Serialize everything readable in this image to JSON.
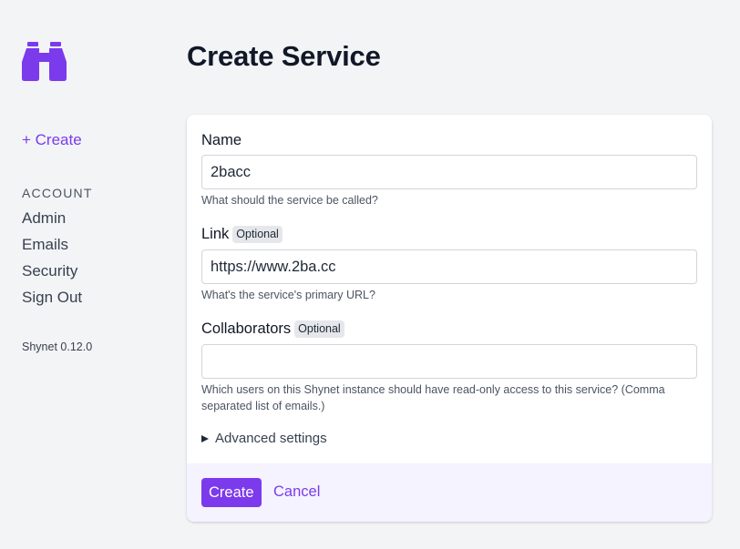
{
  "sidebar": {
    "logo_icon": "binoculars-icon",
    "create_label": "+ Create",
    "account_heading": "ACCOUNT",
    "items": [
      {
        "label": "Admin"
      },
      {
        "label": "Emails"
      },
      {
        "label": "Security"
      },
      {
        "label": "Sign Out"
      }
    ],
    "version": "Shynet 0.12.0"
  },
  "page": {
    "title": "Create Service"
  },
  "form": {
    "name": {
      "label": "Name",
      "value": "2bacc",
      "help": "What should the service be called?"
    },
    "link": {
      "label": "Link",
      "badge": "Optional",
      "value": "https://www.2ba.cc",
      "help": "What's the service's primary URL?"
    },
    "collaborators": {
      "label": "Collaborators",
      "badge": "Optional",
      "value": "",
      "help": "Which users on this Shynet instance should have read-only access to this service? (Comma separated list of emails.)"
    },
    "advanced_label": "Advanced settings",
    "create_button": "Create",
    "cancel_button": "Cancel"
  },
  "colors": {
    "accent": "#7c3aed",
    "background": "#f3f4f6",
    "footer": "#f5f3ff"
  }
}
